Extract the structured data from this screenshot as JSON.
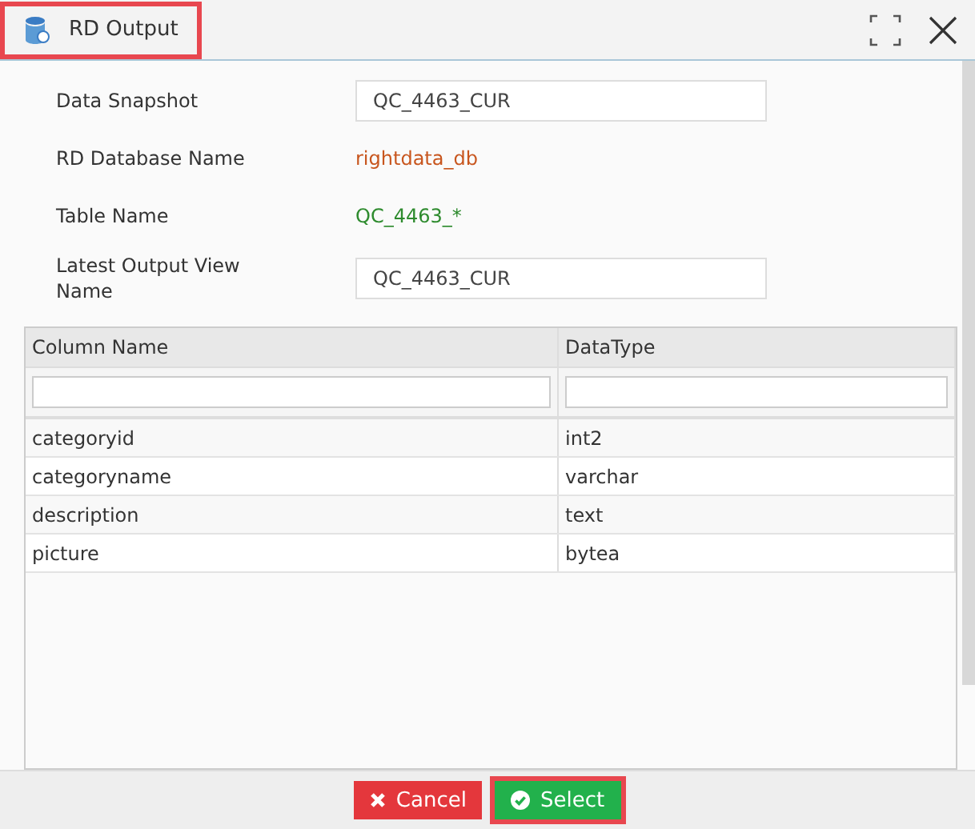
{
  "window": {
    "title": "RD Output",
    "title_highlighted": true
  },
  "fields": [
    {
      "kind": "input",
      "label": "Data Snapshot",
      "value": "QC_4463_CUR"
    },
    {
      "kind": "text",
      "label": "RD Database Name",
      "value": "rightdata_db",
      "color": "#c8561e"
    },
    {
      "kind": "text",
      "label": "Table Name",
      "value": "QC_4463_*",
      "color": "#2e8b2e"
    },
    {
      "kind": "input",
      "label": "Latest Output View Name",
      "value": "QC_4463_CUR"
    }
  ],
  "table": {
    "columns": [
      "Column Name",
      "DataType"
    ],
    "rows": [
      [
        "categoryid",
        "int2"
      ],
      [
        "categoryname",
        "varchar"
      ],
      [
        "description",
        "text"
      ],
      [
        "picture",
        "bytea"
      ]
    ]
  },
  "buttons": [
    {
      "kind": "cancel",
      "label": "Cancel",
      "highlighted": false
    },
    {
      "kind": "select",
      "label": "Select",
      "highlighted": true
    }
  ]
}
